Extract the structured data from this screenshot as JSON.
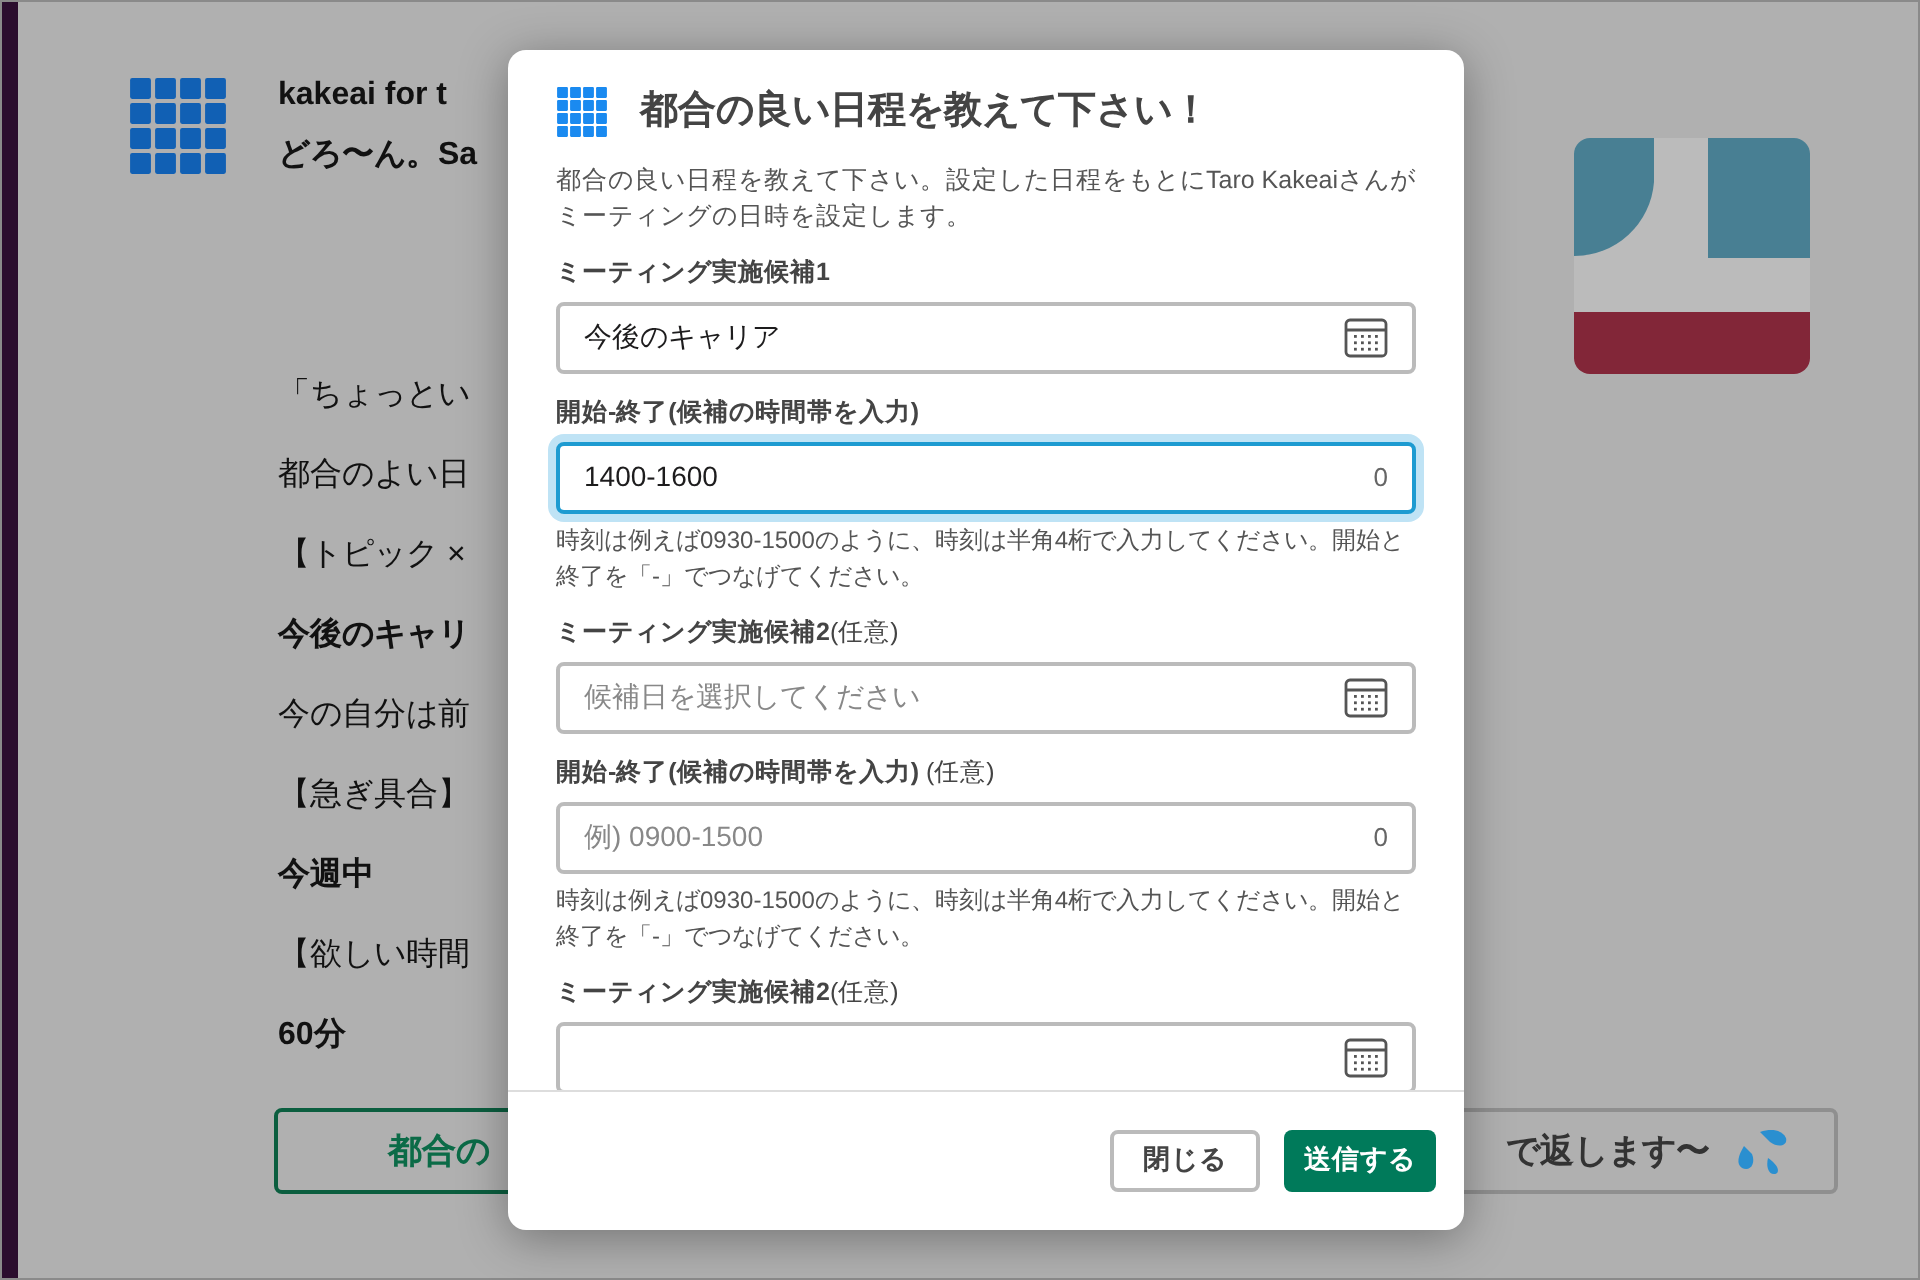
{
  "message": {
    "app_name": "kakeai for t",
    "greeting": "どろ〜ん。Sa",
    "lines": [
      {
        "text": "「ちょっとい",
        "bold": false
      },
      {
        "text": "都合のよい日",
        "bold": false
      },
      {
        "text": "【トピック ×",
        "bold": false
      },
      {
        "text": "今後のキャリ",
        "bold": true
      },
      {
        "text": "今の自分は前",
        "bold": false
      },
      {
        "text": "【急ぎ具合】",
        "bold": false
      },
      {
        "text": "今週中",
        "bold": true
      },
      {
        "text": "【欲しい時間",
        "bold": false
      },
      {
        "text": "60分",
        "bold": true
      }
    ],
    "buttons": [
      {
        "label": "都合の",
        "kind": "primary"
      },
      {
        "label": "で返します〜",
        "kind": "secondary"
      }
    ]
  },
  "modal": {
    "title": "都合の良い日程を教えて下さい！",
    "description": "都合の良い日程を教えて下さい。設定した日程をもとにTaro Kakeaiさんがミーティングの日時を設定します。",
    "fields": [
      {
        "kind": "date",
        "label": "ミーティング実施候補1",
        "value": "今後のキャリア",
        "focused": false
      },
      {
        "kind": "time",
        "label": "開始-終了(候補の時間帯を入力)",
        "value": "1400-1600",
        "counter": "0",
        "focused": true,
        "hint": "時刻は例えば0930-1500のように、時刻は半角4桁で入力してください。開始と終了を「-」でつなげてください。"
      },
      {
        "kind": "date",
        "label": "ミーティング実施候補2",
        "optional_note": "(任意)",
        "placeholder": "候補日を選択してください",
        "focused": false
      },
      {
        "kind": "time",
        "label": "開始-終了(候補の時間帯を入力)",
        "optional_note": " (任意)",
        "placeholder": "例) 0900-1500",
        "counter": "0",
        "focused": false,
        "hint": "時刻は例えば0930-1500のように、時刻は半角4桁で入力してください。開始と終了を「-」でつなげてください。"
      },
      {
        "kind": "date",
        "label": "ミーティング実施候補2",
        "optional_note": "(任意)",
        "focused": false
      }
    ],
    "buttons": [
      {
        "label": "閉じる",
        "kind": "secondary"
      },
      {
        "label": "送信する",
        "kind": "primary"
      }
    ]
  }
}
